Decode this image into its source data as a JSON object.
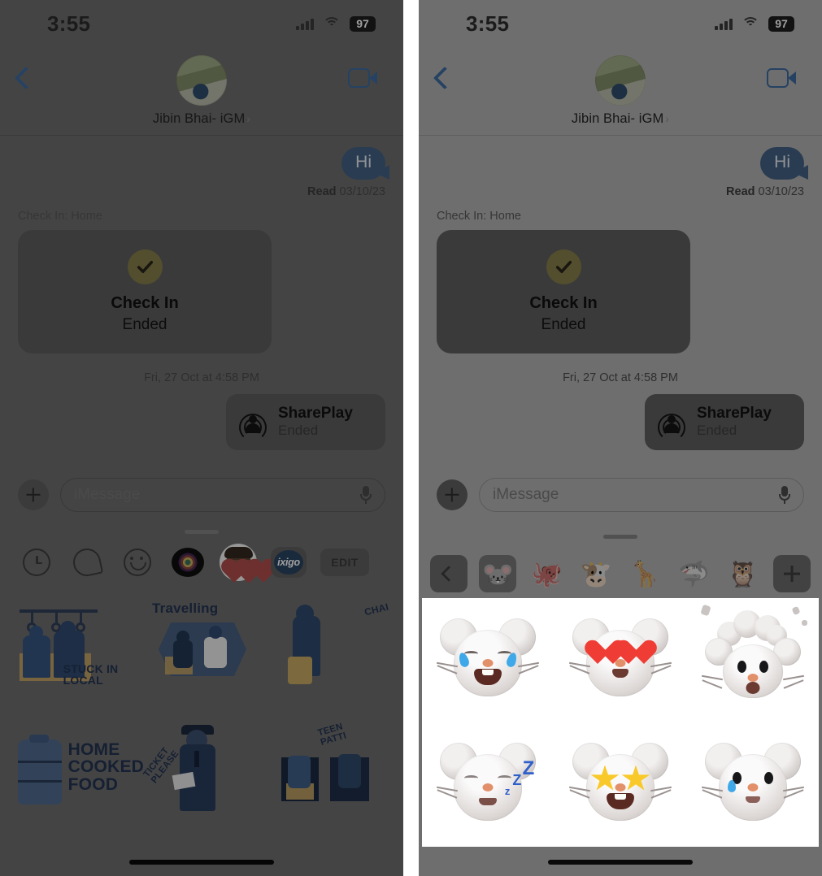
{
  "panels": [
    {
      "id": "left",
      "status": {
        "time": "3:55",
        "battery": "97",
        "signal_icon": "cellular-bars-icon",
        "wifi_icon": "wifi-icon"
      },
      "nav": {
        "back_icon": "back-chevron-icon",
        "contact_name": "Jibin Bhai- iGM",
        "disclosure_chevron": "›",
        "facetime_icon": "facetime-video-icon"
      },
      "conversation": {
        "bubble_text": "Hi",
        "receipt_label": "Read",
        "receipt_date": "03/10/23",
        "checkin_label": "Check In: Home",
        "checkin_title": "Check In",
        "checkin_status": "Ended",
        "checkin_badge_icon": "checkmark-circle-icon",
        "timestamp": "Fri, 27 Oct at 4:58 PM",
        "shareplay_title": "SharePlay",
        "shareplay_status": "Ended",
        "shareplay_icon": "shareplay-icon"
      },
      "input": {
        "plus_icon": "plus-icon",
        "placeholder": "iMessage",
        "mic_icon": "microphone-icon"
      },
      "drawer": {
        "grabber_icon": "drawer-grabber-handle",
        "apps": [
          {
            "name": "recents-clock-app",
            "label": ""
          },
          {
            "name": "stickers-app",
            "label": ""
          },
          {
            "name": "emoji-app",
            "label": ""
          },
          {
            "name": "music-app",
            "label": ""
          },
          {
            "name": "memoji-app",
            "label": "",
            "selected": true
          },
          {
            "name": "ixigo-app",
            "label": "ixigo"
          }
        ],
        "edit_label": "EDIT"
      },
      "stickers": [
        {
          "name": "stuck-in-local-sticker",
          "caption": "STUCK IN LOCAL"
        },
        {
          "name": "travelling-sticker",
          "caption": "Travelling"
        },
        {
          "name": "chai-sticker",
          "caption": "CHAI"
        },
        {
          "name": "home-cooked-food-sticker",
          "caption": "HOME COOKED FOOD"
        },
        {
          "name": "ticket-please-sticker",
          "caption": "TICKET PLEASE"
        },
        {
          "name": "teen-patti-sticker",
          "caption": "TEEN PATTI"
        }
      ]
    },
    {
      "id": "right",
      "status": {
        "time": "3:55",
        "battery": "97",
        "signal_icon": "cellular-bars-icon",
        "wifi_icon": "wifi-icon"
      },
      "nav": {
        "back_icon": "back-chevron-icon",
        "contact_name": "Jibin Bhai- iGM",
        "disclosure_chevron": "›",
        "facetime_icon": "facetime-video-icon"
      },
      "conversation": {
        "bubble_text": "Hi",
        "receipt_label": "Read",
        "receipt_date": "03/10/23",
        "checkin_label": "Check In: Home",
        "checkin_title": "Check In",
        "checkin_status": "Ended",
        "checkin_badge_icon": "checkmark-circle-icon",
        "timestamp": "Fri, 27 Oct at 4:58 PM",
        "shareplay_title": "SharePlay",
        "shareplay_status": "Ended",
        "shareplay_icon": "shareplay-icon"
      },
      "input": {
        "plus_icon": "plus-icon",
        "placeholder": "iMessage",
        "mic_icon": "microphone-icon"
      },
      "memoji_bar": {
        "back_icon": "back-chevron-icon",
        "characters": [
          {
            "name": "memoji-character-mouse",
            "glyph": "🐭",
            "selected": true
          },
          {
            "name": "memoji-character-octopus",
            "glyph": "🐙",
            "selected": false
          },
          {
            "name": "memoji-character-cow",
            "glyph": "🐮",
            "selected": false
          },
          {
            "name": "memoji-character-giraffe",
            "glyph": "🦒",
            "selected": false
          },
          {
            "name": "memoji-character-shark",
            "glyph": "🦈",
            "selected": false
          },
          {
            "name": "memoji-character-owl",
            "glyph": "🦉",
            "selected": false
          }
        ],
        "add_icon": "plus-icon"
      },
      "memoji_stickers": [
        {
          "name": "memoji-sticker-laughing-tears",
          "label": "laughing with tears"
        },
        {
          "name": "memoji-sticker-heart-eyes",
          "label": "heart eyes"
        },
        {
          "name": "memoji-sticker-mind-blown",
          "label": "mind blown"
        },
        {
          "name": "memoji-sticker-sleeping",
          "label": "sleeping"
        },
        {
          "name": "memoji-sticker-star-struck",
          "label": "star struck"
        },
        {
          "name": "memoji-sticker-crying",
          "label": "crying"
        }
      ]
    }
  ],
  "colors": {
    "accent_blue": "#1d6fd0",
    "bubble_blue": "#2f63a6",
    "panel_bg": "#6e6e6e",
    "card_bg": "#5d5d5d",
    "checkin_badge": "#8d8021",
    "sheet_bg": "#ffffff",
    "sticker_ink": "#17356b",
    "sticker_yellow": "#e3a72b"
  }
}
